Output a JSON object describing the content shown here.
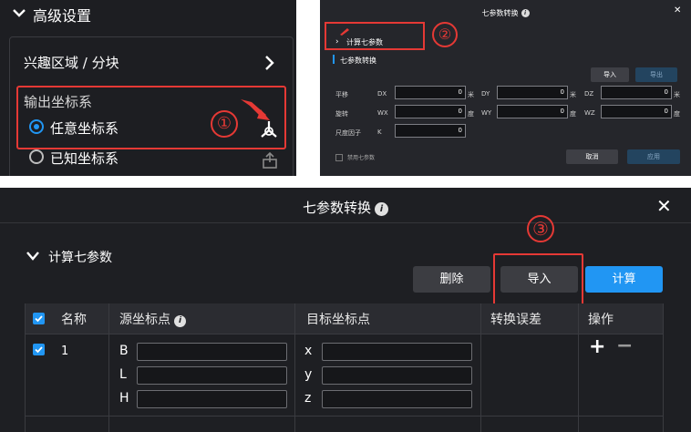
{
  "panel1": {
    "header_title": "高级设置",
    "interest_label": "兴趣区域 / 分块",
    "coord_system_label": "输出坐标系",
    "options": [
      "任意坐标系",
      "已知坐标系"
    ],
    "selected_option": "任意坐标系",
    "step_marker": "①",
    "icons": {
      "expand": "chevron-down-icon",
      "enter": "chevron-right-icon",
      "action": "axis-tripod-icon",
      "secondary": "upload-file-icon"
    }
  },
  "panel2": {
    "title": "七参数转换",
    "info_glyph": "i",
    "close_glyph": "✕",
    "section_title": "计算七参数",
    "step_marker": "②",
    "subsection": "七参数转换",
    "import_label": "导入",
    "export_label": "导出",
    "rows": [
      {
        "label": "平移",
        "fields": [
          {
            "name": "DX",
            "value": "0",
            "unit": "米"
          },
          {
            "name": "DY",
            "value": "0",
            "unit": "米"
          },
          {
            "name": "DZ",
            "value": "0",
            "unit": "米"
          }
        ]
      },
      {
        "label": "旋转",
        "fields": [
          {
            "name": "WX",
            "value": "0",
            "unit": "度"
          },
          {
            "name": "WY",
            "value": "0",
            "unit": "度"
          },
          {
            "name": "WZ",
            "value": "0",
            "unit": "度"
          }
        ]
      }
    ],
    "scale": {
      "label": "尺度因子",
      "name": "K",
      "value": "0"
    },
    "disable_label": "禁用七参数",
    "cancel_label": "取消",
    "apply_label": "应用"
  },
  "panel3": {
    "title": "七参数转换",
    "info_glyph": "i",
    "close_glyph": "✕",
    "section_title": "计算七参数",
    "step_marker": "③",
    "buttons": {
      "delete": "删除",
      "import": "导入",
      "calculate": "计算"
    },
    "columns": [
      "名称",
      "源坐标点",
      "目标坐标点",
      "转换误差",
      "操作"
    ],
    "row": {
      "name": "1",
      "source_axes": [
        "B",
        "L",
        "H"
      ],
      "target_axes": [
        "x",
        "y",
        "z"
      ],
      "error": ""
    },
    "ops": {
      "add": "+",
      "remove": "−"
    },
    "colors": {
      "accent": "#2196f3",
      "highlight": "#e53935"
    }
  }
}
